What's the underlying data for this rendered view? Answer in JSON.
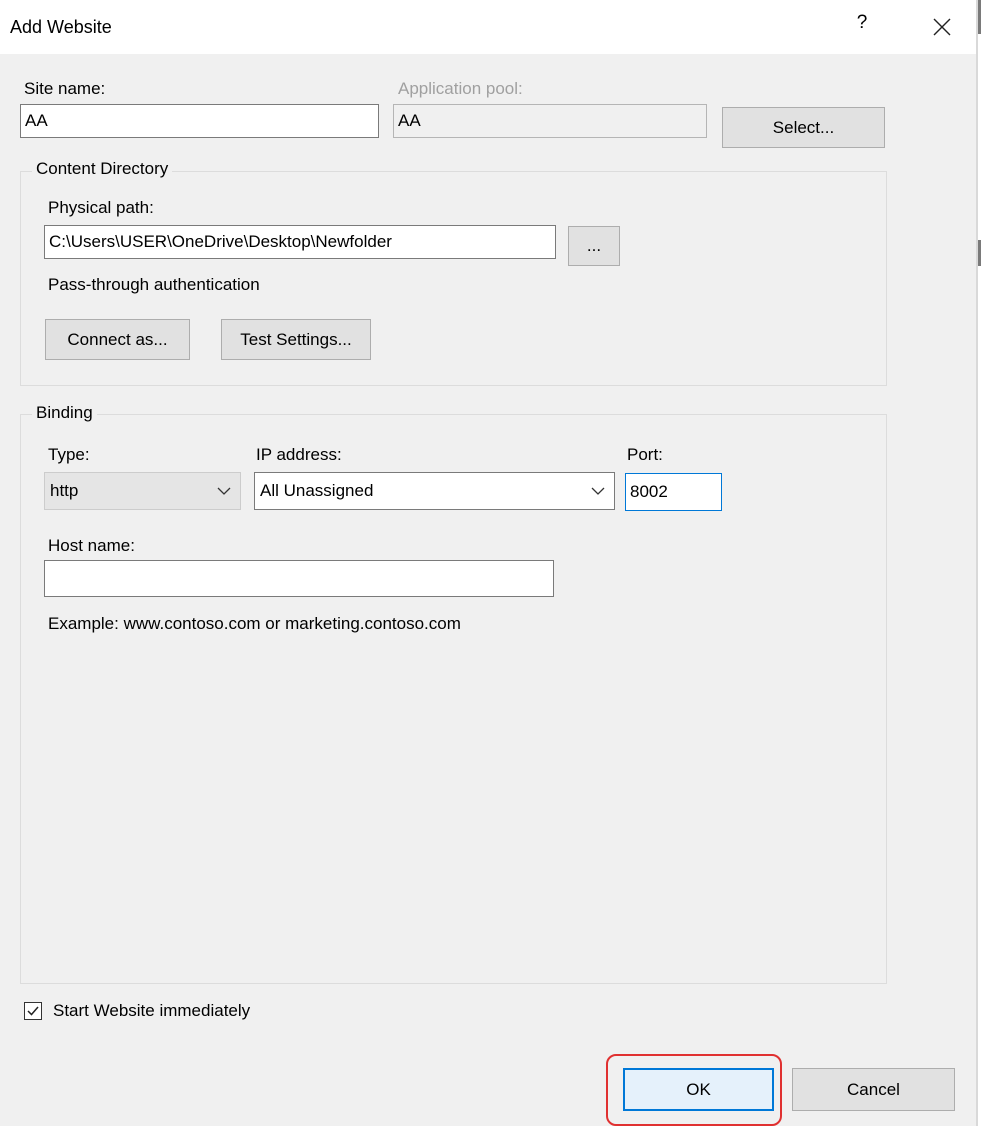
{
  "window": {
    "title": "Add Website",
    "help_label": "?"
  },
  "site": {
    "site_name_label": "Site name:",
    "site_name_value": "AA",
    "app_pool_label": "Application pool:",
    "app_pool_value": "AA",
    "select_label": "Select..."
  },
  "content_directory": {
    "title": "Content Directory",
    "physical_path_label": "Physical path:",
    "physical_path_value": "C:\\Users\\USER\\OneDrive\\Desktop\\Newfolder",
    "browse_label": "...",
    "pass_through_label": "Pass-through authentication",
    "connect_as_label": "Connect as...",
    "test_settings_label": "Test Settings..."
  },
  "binding": {
    "title": "Binding",
    "type_label": "Type:",
    "type_value": "http",
    "ip_label": "IP address:",
    "ip_value": "All Unassigned",
    "port_label": "Port:",
    "port_value": "8002",
    "host_name_label": "Host name:",
    "host_name_value": "",
    "example_text": "Example: www.contoso.com or marketing.contoso.com"
  },
  "start_immediately": {
    "label": "Start Website immediately",
    "checked": true
  },
  "footer": {
    "ok_label": "OK",
    "cancel_label": "Cancel"
  },
  "colors": {
    "focus_accent": "#0078d7",
    "highlight": "#e03030",
    "dialog_bg": "#f0f0f0"
  }
}
